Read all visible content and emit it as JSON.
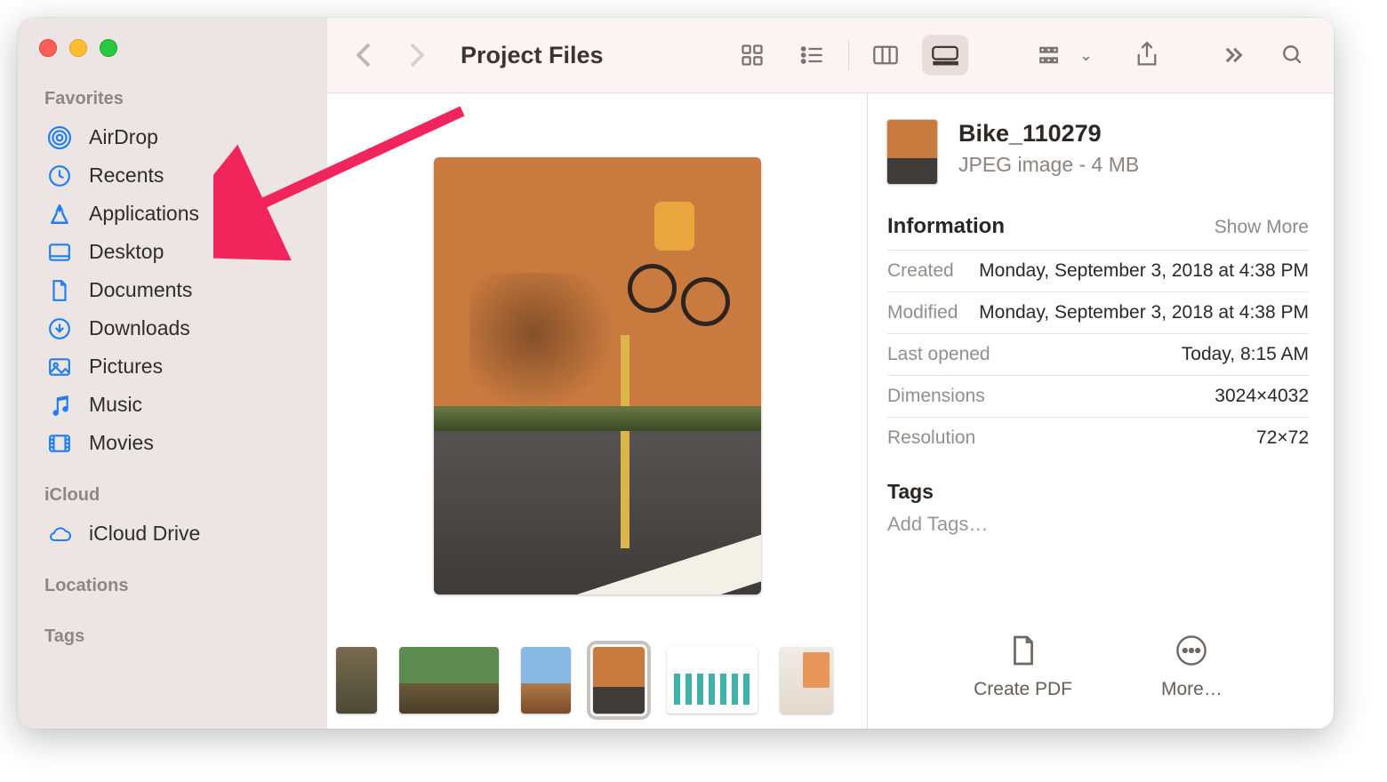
{
  "window_title": "Project Files",
  "sidebar": {
    "sections": {
      "favorites_label": "Favorites",
      "icloud_label": "iCloud",
      "locations_label": "Locations",
      "tags_label": "Tags"
    },
    "favorites": [
      {
        "label": "AirDrop"
      },
      {
        "label": "Recents"
      },
      {
        "label": "Applications"
      },
      {
        "label": "Desktop"
      },
      {
        "label": "Documents"
      },
      {
        "label": "Downloads"
      },
      {
        "label": "Pictures"
      },
      {
        "label": "Music"
      },
      {
        "label": "Movies"
      }
    ],
    "icloud": [
      {
        "label": "iCloud Drive"
      }
    ]
  },
  "view_mode": "gallery",
  "thumbnails_count": 6,
  "selected_thumbnail_index": 3,
  "file": {
    "name": "Bike_110279",
    "subtitle": "JPEG image - 4 MB"
  },
  "info": {
    "heading": "Information",
    "show_more": "Show More",
    "rows": {
      "created_k": "Created",
      "created_v": "Monday, September 3, 2018 at 4:38 PM",
      "modified_k": "Modified",
      "modified_v": "Monday, September 3, 2018 at 4:38 PM",
      "last_opened_k": "Last opened",
      "last_opened_v": "Today, 8:15 AM",
      "dimensions_k": "Dimensions",
      "dimensions_v": "3024×4032",
      "resolution_k": "Resolution",
      "resolution_v": "72×72"
    }
  },
  "tags": {
    "heading": "Tags",
    "placeholder": "Add Tags…"
  },
  "actions": {
    "create_pdf": "Create PDF",
    "more": "More…"
  },
  "annotation": {
    "type": "arrow",
    "target": "sidebar-item-applications",
    "color": "#f1245b"
  }
}
